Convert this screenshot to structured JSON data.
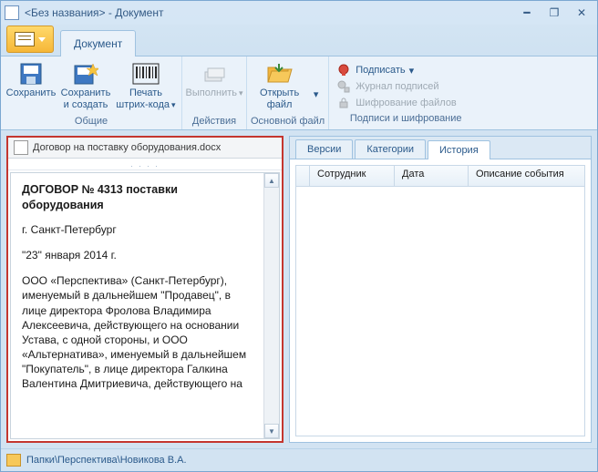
{
  "title": "<Без названия> - Документ",
  "menu_tab": "Документ",
  "ribbon": {
    "save": "Сохранить",
    "save_create": "Сохранить и создать",
    "barcode": "Печать штрих-кода",
    "group_general": "Общие",
    "execute": "Выполнить",
    "group_actions": "Действия",
    "open_file": "Открыть файл",
    "group_mainfile": "Основной файл",
    "sign": "Подписать",
    "sig_log": "Журнал подписей",
    "encrypt": "Шифрование файлов",
    "group_sig": "Подписи и шифрование"
  },
  "file_tab": "Договор на поставку оборудования.docx",
  "document": {
    "heading": "ДОГОВОР № 4313 поставки оборудования",
    "city": "г. Санкт-Петербург",
    "date": "\"23\"  января 2014 г.",
    "body": "ООО «Перспектива» (Санкт-Петербург), именуемый в дальнейшем \"Продавец\", в лице директора Фролова Владимира Алексеевича, действующего на основании Устава, с одной стороны, и ООО «Альтернатива», именуемый в дальнейшем \"Покупатель\", в лице директора  Галкина Валентина Дмитриевича, действующего на"
  },
  "tabs": {
    "versions": "Версии",
    "categories": "Категории",
    "history": "История"
  },
  "columns": {
    "employee": "Сотрудник",
    "date": "Дата",
    "event": "Описание события"
  },
  "breadcrumb": "Папки\\Перспектива\\Новикова В.А."
}
